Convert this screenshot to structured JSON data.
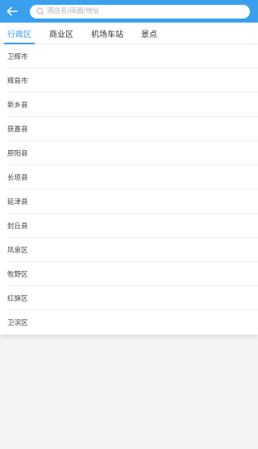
{
  "header": {
    "back_icon": "arrow-left-icon",
    "search_icon": "search-icon",
    "search_placeholder": "酒店名/商圈/地址",
    "search_value": ""
  },
  "tabs": [
    {
      "label": "行政区",
      "active": true
    },
    {
      "label": "商业区",
      "active": false
    },
    {
      "label": "机场车站",
      "active": false
    },
    {
      "label": "景点",
      "active": false
    }
  ],
  "districts": [
    "卫辉市",
    "辉县市",
    "新乡县",
    "获嘉县",
    "原阳县",
    "长垣县",
    "延津县",
    "封丘县",
    "凤泉区",
    "牧野区",
    "红旗区",
    "卫滨区"
  ],
  "colors": {
    "accent": "#3aa0ee",
    "background": "#f4f4f6"
  }
}
